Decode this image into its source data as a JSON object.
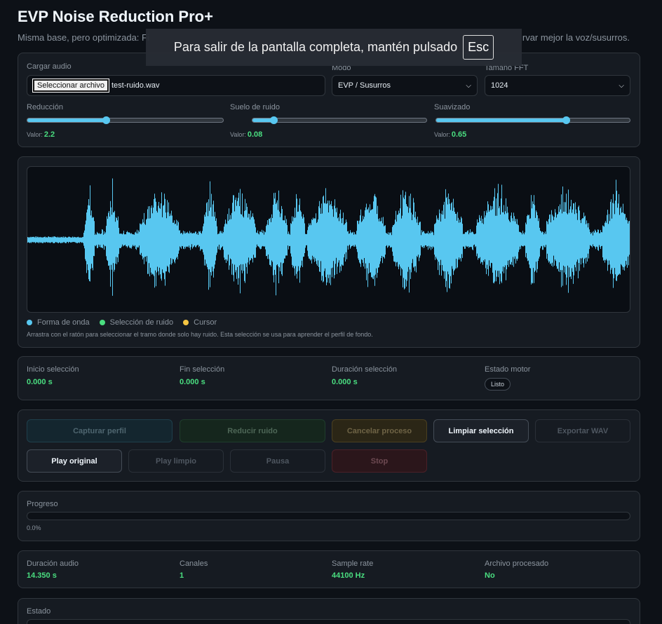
{
  "header": {
    "title": "EVP Noise Reduction Pro+",
    "subtitle": "Misma base, pero optimizada: Fi",
    "subtitle_tail": "rvar mejor la voz/susurros."
  },
  "fullscreen_toast": {
    "text": "Para salir de la pantalla completa, mantén pulsado",
    "key": "Esc"
  },
  "controls": {
    "load_label": "Cargar audio",
    "file_button": "Seleccionar archivo",
    "file_name": "test-ruido.wav",
    "mode_label": "Modo",
    "mode_value": "EVP / Susurros",
    "fft_label": "Tamaño FFT",
    "fft_value": "1024",
    "value_prefix": "Valor:",
    "sliders": [
      {
        "label": "Reducción",
        "value": "2.2",
        "fraction": 0.4
      },
      {
        "label": "Suelo de ruido",
        "value": "0.08",
        "fraction": 0.12
      },
      {
        "label": "Suavizado",
        "value": "0.65",
        "fraction": 0.67
      }
    ]
  },
  "waveform": {
    "legend": [
      {
        "label": "Forma de onda",
        "color": "#58c7f0"
      },
      {
        "label": "Selección de ruido",
        "color": "#4ade80"
      },
      {
        "label": "Cursor",
        "color": "#f5c542"
      }
    ],
    "hint": "Arrastra con el ratón para seleccionar el tramo donde solo hay ruido. Esta selección se usa para aprender el perfil de fondo.",
    "color": "#58c7f0"
  },
  "selection": {
    "start_label": "Inicio selección",
    "start_value": "0.000 s",
    "end_label": "Fin selección",
    "end_value": "0.000 s",
    "duration_label": "Duración selección",
    "duration_value": "0.000 s",
    "engine_label": "Estado motor",
    "engine_value": "Listo"
  },
  "actions": {
    "capture": "Capturar perfil",
    "reduce": "Reducir ruido",
    "cancel": "Cancelar proceso",
    "clear": "Limpiar selección",
    "export": "Exportar WAV",
    "play_original": "Play original",
    "play_clean": "Play limpio",
    "pause": "Pausa",
    "stop": "Stop"
  },
  "progress": {
    "label": "Progreso",
    "percent": 0.0,
    "value_text": "0.0%"
  },
  "audio_info": {
    "duration_label": "Duración audio",
    "duration_value": "14.350 s",
    "channels_label": "Canales",
    "channels_value": "1",
    "samplerate_label": "Sample rate",
    "samplerate_value": "44100 Hz",
    "processed_label": "Archivo procesado",
    "processed_value": "No"
  },
  "status": {
    "label": "Estado"
  }
}
